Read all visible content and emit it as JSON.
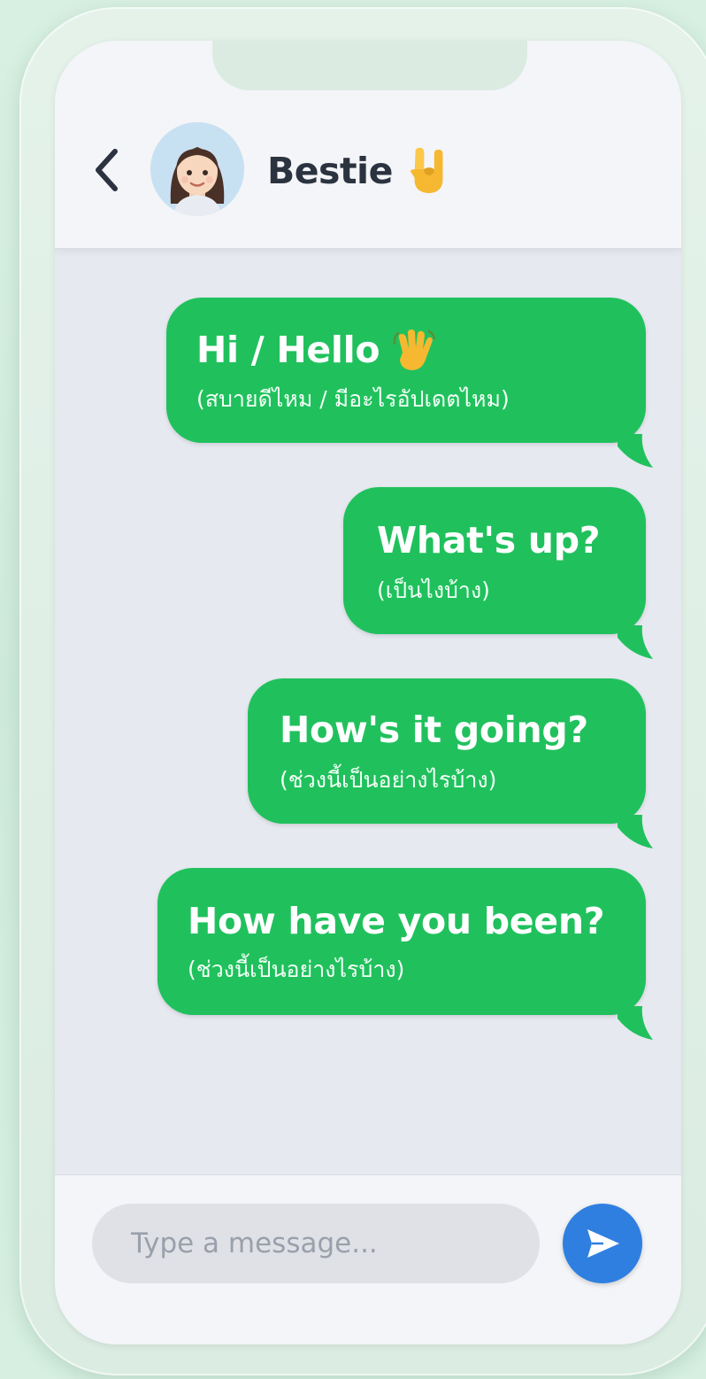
{
  "header": {
    "back_icon": "chevron-left-icon",
    "avatar_icon": "woman-face-avatar",
    "contact_name": "Bestie",
    "name_emoji": "rock-hand-icon"
  },
  "messages": [
    {
      "main": "Hi / Hello",
      "sub": "(สบายดีไหม / มีอะไรอัปเดตไหม)",
      "emoji": "waving-hand-icon"
    },
    {
      "main": "What's up?",
      "sub": "(เป็นไงบ้าง)"
    },
    {
      "main": "How's it going?",
      "sub": "(ช่วงนี้เป็นอย่างไรบ้าง)"
    },
    {
      "main": "How have you been?",
      "sub": "(ช่วงนี้เป็นอย่างไรบ้าง)"
    }
  ],
  "composer": {
    "placeholder": "Type a message...",
    "send_icon": "send-arrow-icon"
  },
  "colors": {
    "bubble": "#20c15d",
    "send_button": "#2f7fe0",
    "background": "#d8f0e2"
  }
}
